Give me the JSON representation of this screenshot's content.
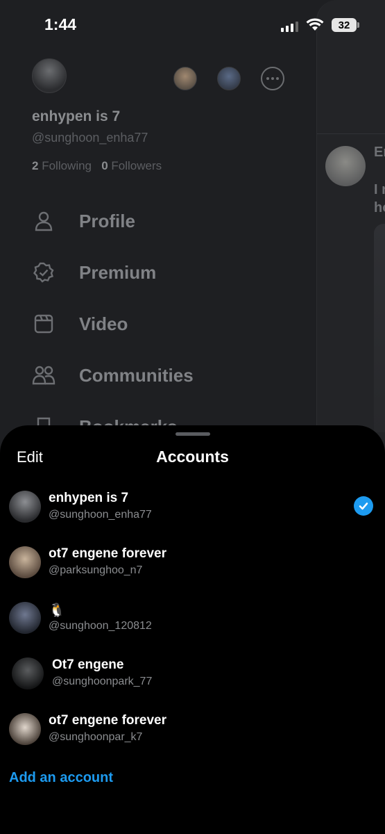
{
  "status_bar": {
    "time": "1:44",
    "battery": "32"
  },
  "drawer": {
    "display_name": "enhypen is 7",
    "handle": "@sunghoon_enha77",
    "following_count": "2",
    "following_label": "Following",
    "followers_count": "0",
    "followers_label": "Followers",
    "menu": [
      {
        "label": "Profile",
        "icon": "person-icon"
      },
      {
        "label": "Premium",
        "icon": "verified-badge-icon"
      },
      {
        "label": "Video",
        "icon": "video-icon"
      },
      {
        "label": "Communities",
        "icon": "communities-icon"
      },
      {
        "label": "Bookmarks",
        "icon": "bookmark-icon"
      }
    ]
  },
  "timeline_peek": {
    "lines": [
      "Er",
      "I r",
      "ho"
    ]
  },
  "sheet": {
    "edit_label": "Edit",
    "title": "Accounts",
    "accounts": [
      {
        "name": "enhypen is 7",
        "handle": "@sunghoon_enha77",
        "selected": true
      },
      {
        "name": "ot7 engene forever",
        "handle": "@parksunghoo_n7",
        "selected": false
      },
      {
        "name": "🐧",
        "handle": "@sunghoon_120812",
        "selected": false
      },
      {
        "name": "Ot7 engene",
        "handle": "@sunghoonpark_77",
        "selected": false
      },
      {
        "name": "ot7 engene forever",
        "handle": "@sunghoonpar_k7",
        "selected": false
      }
    ],
    "add_account_label": "Add an account"
  },
  "colors": {
    "accent": "#1d9bf0",
    "sheet_bg": "#000000",
    "dim_bg": "#1e1f22"
  }
}
